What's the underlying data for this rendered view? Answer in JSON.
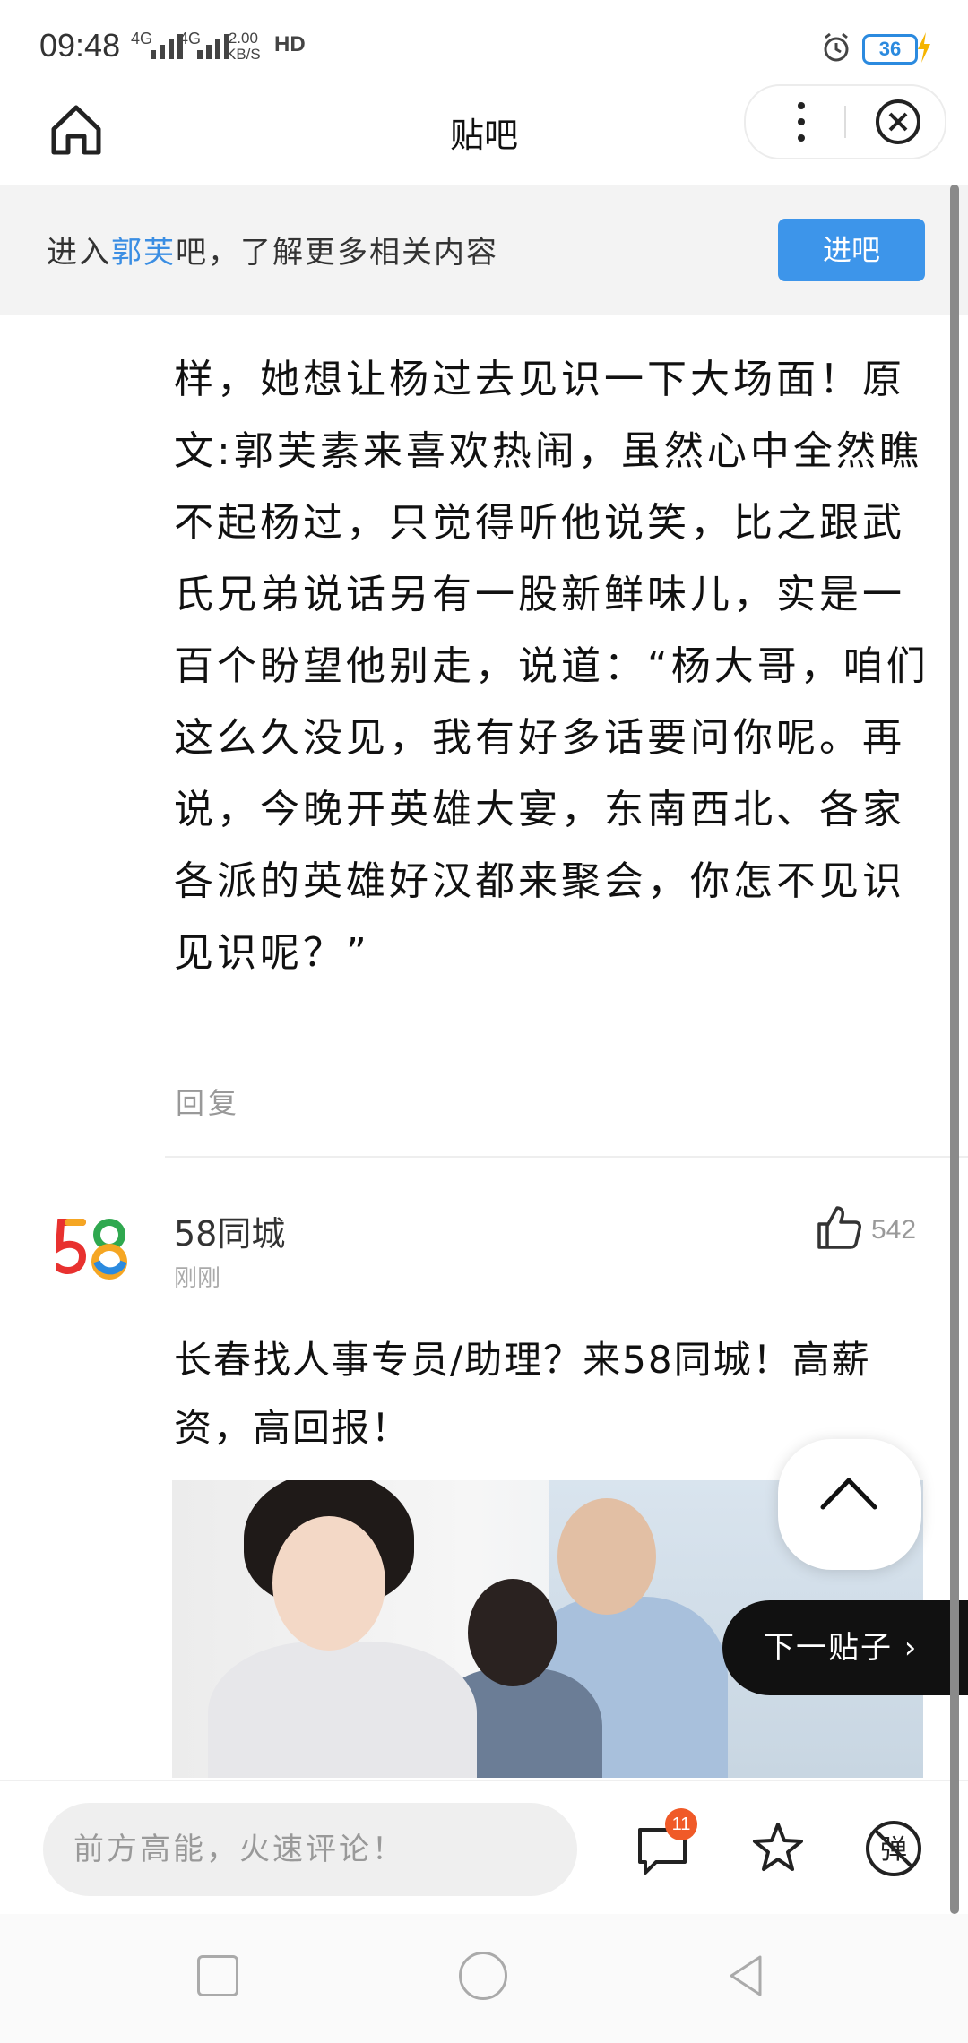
{
  "status_bar": {
    "time": "09:48",
    "net1": "4G",
    "net2": "4G",
    "speed_value": "2.00",
    "speed_unit": "KB/S",
    "hd": "HD",
    "battery": "36"
  },
  "header": {
    "title": "贴吧"
  },
  "banner": {
    "prefix": "进入",
    "forum": "郭芙",
    "suffix": "吧，了解更多相关内容",
    "enter_label": "进吧"
  },
  "post": {
    "text": "样，她想让杨过去见识一下大场面！原文:郭芙素来喜欢热闹，虽然心中全然瞧不起杨过，只觉得听他说笑，比之跟武氏兄弟说话另有一股新鲜味儿，实是一百个盼望他别走，说道：“杨大哥，咱们这么久没见，我有好多话要问你呢。再说，今晚开英雄大宴，东南西北、各家各派的英雄好汉都来聚会，你怎不见识见识呢？”",
    "reply_label": "回复"
  },
  "ad": {
    "name": "58同城",
    "time": "刚刚",
    "like_count": "542",
    "text": "长春找人事专员/助理？来58同城！高薪资，高回报！"
  },
  "floating": {
    "next_post_label": "下一贴子 ›"
  },
  "bottom_bar": {
    "comment_placeholder": "前方高能，火速评论！",
    "comment_badge": "11"
  },
  "colors": {
    "accent": "#3d95ea",
    "badge": "#f05a28"
  }
}
